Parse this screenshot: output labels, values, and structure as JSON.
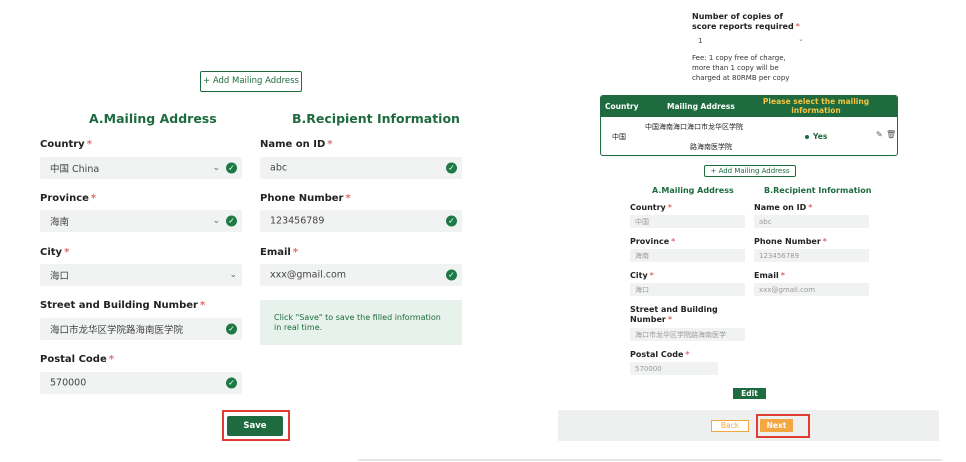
{
  "left": {
    "add_address_label": "+ Add Mailing Address",
    "section_a_title": "A.Mailing Address",
    "section_b_title": "B.Recipient Information",
    "country": {
      "label": "Country",
      "value": "中国 China"
    },
    "province": {
      "label": "Province",
      "value": "海南"
    },
    "city": {
      "label": "City",
      "value": "海口"
    },
    "street": {
      "label": "Street and Building Number",
      "value": "海口市龙华区学院路海南医学院"
    },
    "postal": {
      "label": "Postal Code",
      "value": "570000"
    },
    "name_on_id": {
      "label": "Name on ID",
      "value": "abc"
    },
    "phone": {
      "label": "Phone Number",
      "value": "123456789"
    },
    "email": {
      "label": "Email",
      "value": "xxx@gmail.com"
    },
    "hint": "Click \"Save\" to save the filled information in real time.",
    "save_label": "Save",
    "required_mark": "*"
  },
  "right": {
    "copies_label": "Number of copies of score reports required",
    "copies_value": "1",
    "fee_note": "Fee: 1 copy free of charge, more than 1 copy will be charged at 80RMB per copy",
    "table": {
      "headers": [
        "Country",
        "Mailing Address",
        "Please select the mailing information"
      ],
      "row": {
        "country": "中国",
        "address_line1": "中国海南海口海口市龙华区学院",
        "address_line2": "路海南医学院",
        "selected": "Yes"
      }
    },
    "add_address_label": "+ Add Mailing Address",
    "section_a_title": "A.Mailing Address",
    "section_b_title": "B.Recipient Information",
    "country": {
      "label": "Country",
      "value": "中国"
    },
    "province": {
      "label": "Province",
      "value": "海南"
    },
    "city": {
      "label": "City",
      "value": "海口"
    },
    "street": {
      "label_line1": "Street and Building",
      "label_line2": "Number",
      "value": "海口市龙华区学院路海南医学"
    },
    "postal": {
      "label": "Postal Code",
      "value": "570000"
    },
    "name_on_id": {
      "label": "Name on ID",
      "value": "abc"
    },
    "phone": {
      "label": "Phone Number",
      "value": "123456789"
    },
    "email": {
      "label": "Email",
      "value": "xxx@gmail.com"
    },
    "edit_label": "Edit",
    "back_label": "Back",
    "next_label": "Next",
    "required_mark": "*"
  },
  "colors": {
    "brand_green": "#1d6b3e",
    "highlight_red": "#e03c31",
    "header_yellow": "#f5c542",
    "next_orange": "#f4a640"
  },
  "icons": [
    "check-circle-icon",
    "chevron-down-icon",
    "edit-icon",
    "trash-icon"
  ]
}
